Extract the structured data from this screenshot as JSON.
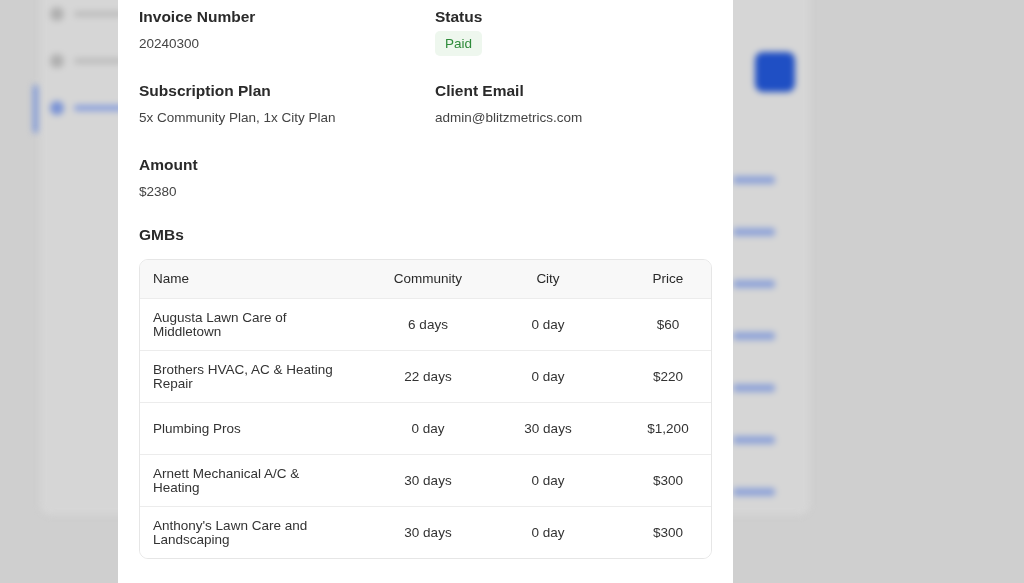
{
  "fields": [
    {
      "label": "Invoice Number",
      "value": "20240300",
      "kind": "text"
    },
    {
      "label": "Status",
      "value": "Paid",
      "kind": "badge"
    },
    {
      "label": "Subscription Plan",
      "value": "5x Community Plan, 1x City Plan",
      "kind": "text"
    },
    {
      "label": "Client Email",
      "value": "admin@blitzmetrics.com",
      "kind": "text"
    },
    {
      "label": "Amount",
      "value": "$2380",
      "kind": "text"
    }
  ],
  "gmbs": {
    "title": "GMBs",
    "columns": [
      "Name",
      "Community",
      "City",
      "Price"
    ],
    "rows": [
      [
        "Augusta Lawn Care of Middletown",
        "6 days",
        "0 day",
        "$60"
      ],
      [
        "Brothers HVAC, AC & Heating Repair",
        "22 days",
        "0 day",
        "$220"
      ],
      [
        "Plumbing Pros",
        "0 day",
        "30 days",
        "$1,200"
      ],
      [
        "Arnett Mechanical A/C & Heating",
        "30 days",
        "0 day",
        "$300"
      ],
      [
        "Anthony's Lawn Care and Landscaping",
        "30 days",
        "0 day",
        "$300"
      ]
    ]
  }
}
